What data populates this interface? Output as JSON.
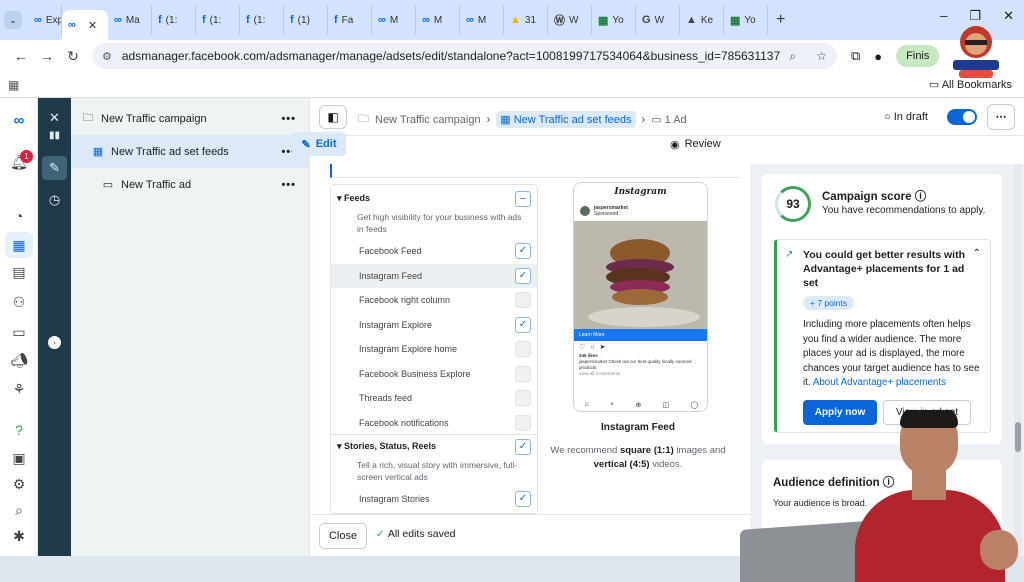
{
  "browser": {
    "tabs": [
      {
        "label": "Exp",
        "icon": "meta-icon",
        "glyph": "∞"
      },
      {
        "label": "",
        "icon": "meta-icon",
        "glyph": "∞",
        "active": true
      },
      {
        "label": "Ma",
        "icon": "meta-icon",
        "glyph": "∞"
      },
      {
        "label": "(1:",
        "icon": "facebook-icon",
        "glyph": "f"
      },
      {
        "label": "(1:",
        "icon": "facebook-icon",
        "glyph": "f"
      },
      {
        "label": "(1:",
        "icon": "facebook-icon",
        "glyph": "f"
      },
      {
        "label": "(1)",
        "icon": "facebook-icon",
        "glyph": "f"
      },
      {
        "label": "Fa",
        "icon": "facebook-icon",
        "glyph": "f"
      },
      {
        "label": "M",
        "icon": "meta-icon",
        "glyph": "∞"
      },
      {
        "label": "M",
        "icon": "meta-icon",
        "glyph": "∞"
      },
      {
        "label": "M",
        "icon": "meta-icon",
        "glyph": "∞"
      },
      {
        "label": "31",
        "icon": "drive-icon",
        "glyph": "▲"
      },
      {
        "label": "W",
        "icon": "wordpress-icon",
        "glyph": "Ⓦ"
      },
      {
        "label": "Yo",
        "icon": "sheets-icon",
        "glyph": "▦"
      },
      {
        "label": "W",
        "icon": "google-icon",
        "glyph": "G"
      },
      {
        "label": "Ke",
        "icon": "ads-icon",
        "glyph": "▲"
      },
      {
        "label": "Yo",
        "icon": "sheets-icon",
        "glyph": "▦"
      }
    ],
    "url": "adsmanager.facebook.com/adsmanager/manage/adsets/edit/standalone?act=1008199717534064&business_id=785631137036741...",
    "finish_label": "Finis",
    "all_bookmarks": "All Bookmarks",
    "colors": {
      "tabbar": "#d3e3fd",
      "accent": "#0a66d8"
    }
  },
  "rail": {
    "notification_count": "1"
  },
  "tree": {
    "campaign": "New Traffic campaign",
    "adset": "New Traffic ad set feeds",
    "ad": "New Traffic ad"
  },
  "topbar": {
    "crumb_campaign": "New Traffic campaign",
    "crumb_adset": "New Traffic ad set feeds",
    "crumb_ad": "1 Ad",
    "status": "In draft"
  },
  "modes": {
    "edit": "Edit",
    "review": "Review"
  },
  "placements": {
    "feeds_header": "Feeds",
    "feeds_desc": "Get high visibility for your business with ads in feeds",
    "items": [
      {
        "label": "Facebook Feed",
        "checked": true
      },
      {
        "label": "Instagram Feed",
        "checked": true
      },
      {
        "label": "Facebook right column",
        "checked": false
      },
      {
        "label": "Instagram Explore",
        "checked": true
      },
      {
        "label": "Instagram Explore home",
        "checked": false
      },
      {
        "label": "Facebook Business Explore",
        "checked": false
      },
      {
        "label": "Threads feed",
        "checked": false
      },
      {
        "label": "Facebook notifications",
        "checked": false
      }
    ],
    "stories_header": "Stories, Status, Reels",
    "stories_desc": "Tell a rich, visual story with immersive, full-screen vertical ads",
    "stories_items": [
      {
        "label": "Instagram Stories",
        "checked": true
      }
    ]
  },
  "preview": {
    "app_name": "Instagram",
    "username": "jaspersmarket",
    "sponsored": "Sponsored",
    "learn_more": "Learn More",
    "likes": "345 likes",
    "caption": "jaspersmarket Check out our best quality locally sourced products.",
    "comments": "View all 4 comments",
    "title": "Instagram Feed",
    "note_pre": "We recommend ",
    "note_square": "square (1:1)",
    "note_mid": " images and ",
    "note_vertical": "vertical (4:5)",
    "note_post": " videos."
  },
  "footer": {
    "close": "Close",
    "saved": "All edits saved"
  },
  "score_card": {
    "score": "93",
    "title": "Campaign score",
    "subtitle": "You have recommendations to apply.",
    "rec_title": "You could get better results with Advantage+ placements for 1 ad set",
    "rec_badge": "+ 7 points",
    "rec_body": "Including more placements often helps you find a wider audience. The more places your ad is displayed, the more chances your target audience has to see it.",
    "rec_link": "About Advantage+ placements",
    "apply": "Apply now",
    "view": "View in ad set"
  },
  "audience_card": {
    "title": "Audience definition",
    "subtitle": "Your audience is broad."
  }
}
